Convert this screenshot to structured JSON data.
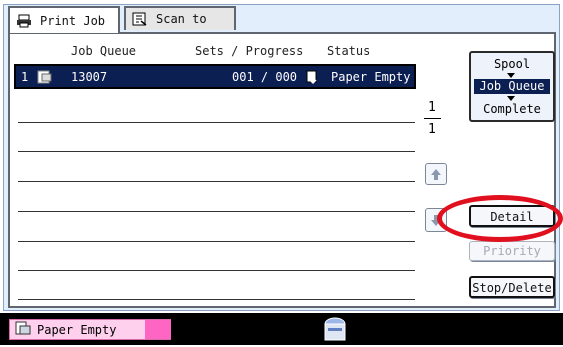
{
  "tabs": [
    {
      "label": "Print Job",
      "active": true,
      "icon": "printer-icon"
    },
    {
      "label": "Scan to",
      "active": false,
      "icon": "scan-icon"
    }
  ],
  "columns": {
    "queue": "Job Queue",
    "progress": "Sets / Progress",
    "status": "Status"
  },
  "jobs": [
    {
      "index": "1",
      "id": "13007",
      "progress": "001 / 000",
      "status": "Paper Empty"
    }
  ],
  "view_modes": {
    "spool": "Spool",
    "job_queue": "Job Queue",
    "complete": "Complete",
    "selected": "Job Queue"
  },
  "pagination": {
    "current": "1",
    "total": "1"
  },
  "buttons": {
    "detail": "Detail",
    "priority": "Priority",
    "stop_delete": "Stop/Delete"
  },
  "status_bar": {
    "message": "Paper Empty"
  },
  "colors": {
    "selection": "#0c1f52",
    "panel": "#e3eefc",
    "highlight": "#e0101e",
    "status_chip": "#ffd0ee"
  }
}
